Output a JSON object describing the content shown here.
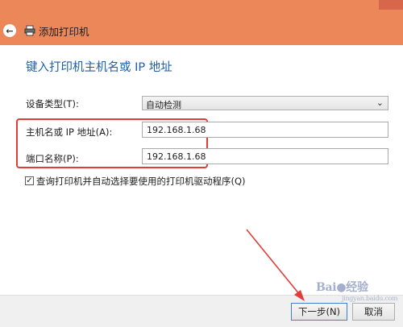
{
  "window": {
    "title": "添加打印机",
    "back_icon": "back-arrow-icon",
    "printer_icon": "printer-icon",
    "accent_color": "#ec875a"
  },
  "main": {
    "heading": "键入打印机主机名或 IP 地址",
    "device_type": {
      "label": "设备类型(T):",
      "selected": "自动检测"
    },
    "hostname": {
      "label": "主机名或 IP 地址(A):",
      "value": "192.168.1.68"
    },
    "port_name": {
      "label": "端口名称(P):",
      "value": "192.168.1.68"
    },
    "auto_driver": {
      "label": "查询打印机并自动选择要使用的打印机驱动程序(Q)",
      "checked": true
    }
  },
  "footer": {
    "next_label": "下一步(N)",
    "cancel_label": "取消"
  },
  "watermark": {
    "brand": "Bai",
    "suffix": "经验",
    "url": "jingyan.baidu.com"
  },
  "annotation_color": "#e23c38"
}
